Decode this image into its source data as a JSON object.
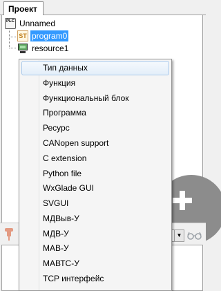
{
  "tabs": [
    {
      "label": "Проект"
    }
  ],
  "tree": {
    "root": {
      "label": "Unnamed",
      "icon": "plc-icon",
      "icon_text": "PLC"
    },
    "children": [
      {
        "label": "program0",
        "icon": "st-program-icon",
        "icon_text": "ST",
        "selected": true
      },
      {
        "label": "resource1",
        "icon": "resource-icon",
        "selected": false
      }
    ]
  },
  "context_menu": {
    "items": [
      {
        "label": "Тип данных",
        "highlighted": true
      },
      {
        "label": "Функция"
      },
      {
        "label": "Функциональный блок"
      },
      {
        "label": "Программа"
      },
      {
        "label": "Ресурс"
      },
      {
        "label": "CANopen support"
      },
      {
        "label": "C extension"
      },
      {
        "label": "Python file"
      },
      {
        "label": "WxGlade GUI"
      },
      {
        "label": "SVGUI"
      },
      {
        "label": "МДВыв-У"
      },
      {
        "label": "МДВ-У"
      },
      {
        "label": "МАВ-У"
      },
      {
        "label": "МАВТС-У"
      },
      {
        "label": "TCP интерфейс"
      }
    ]
  },
  "toolbar": {
    "pin_icon": "pin-icon",
    "combo_value": "",
    "glasses_icon": "glasses-icon"
  },
  "add_button": {
    "icon": "plus-icon"
  },
  "colors": {
    "selection": "#3399ff",
    "add_circle": "#8c8c8c",
    "menu_highlight_border": "#a8c8ea"
  }
}
